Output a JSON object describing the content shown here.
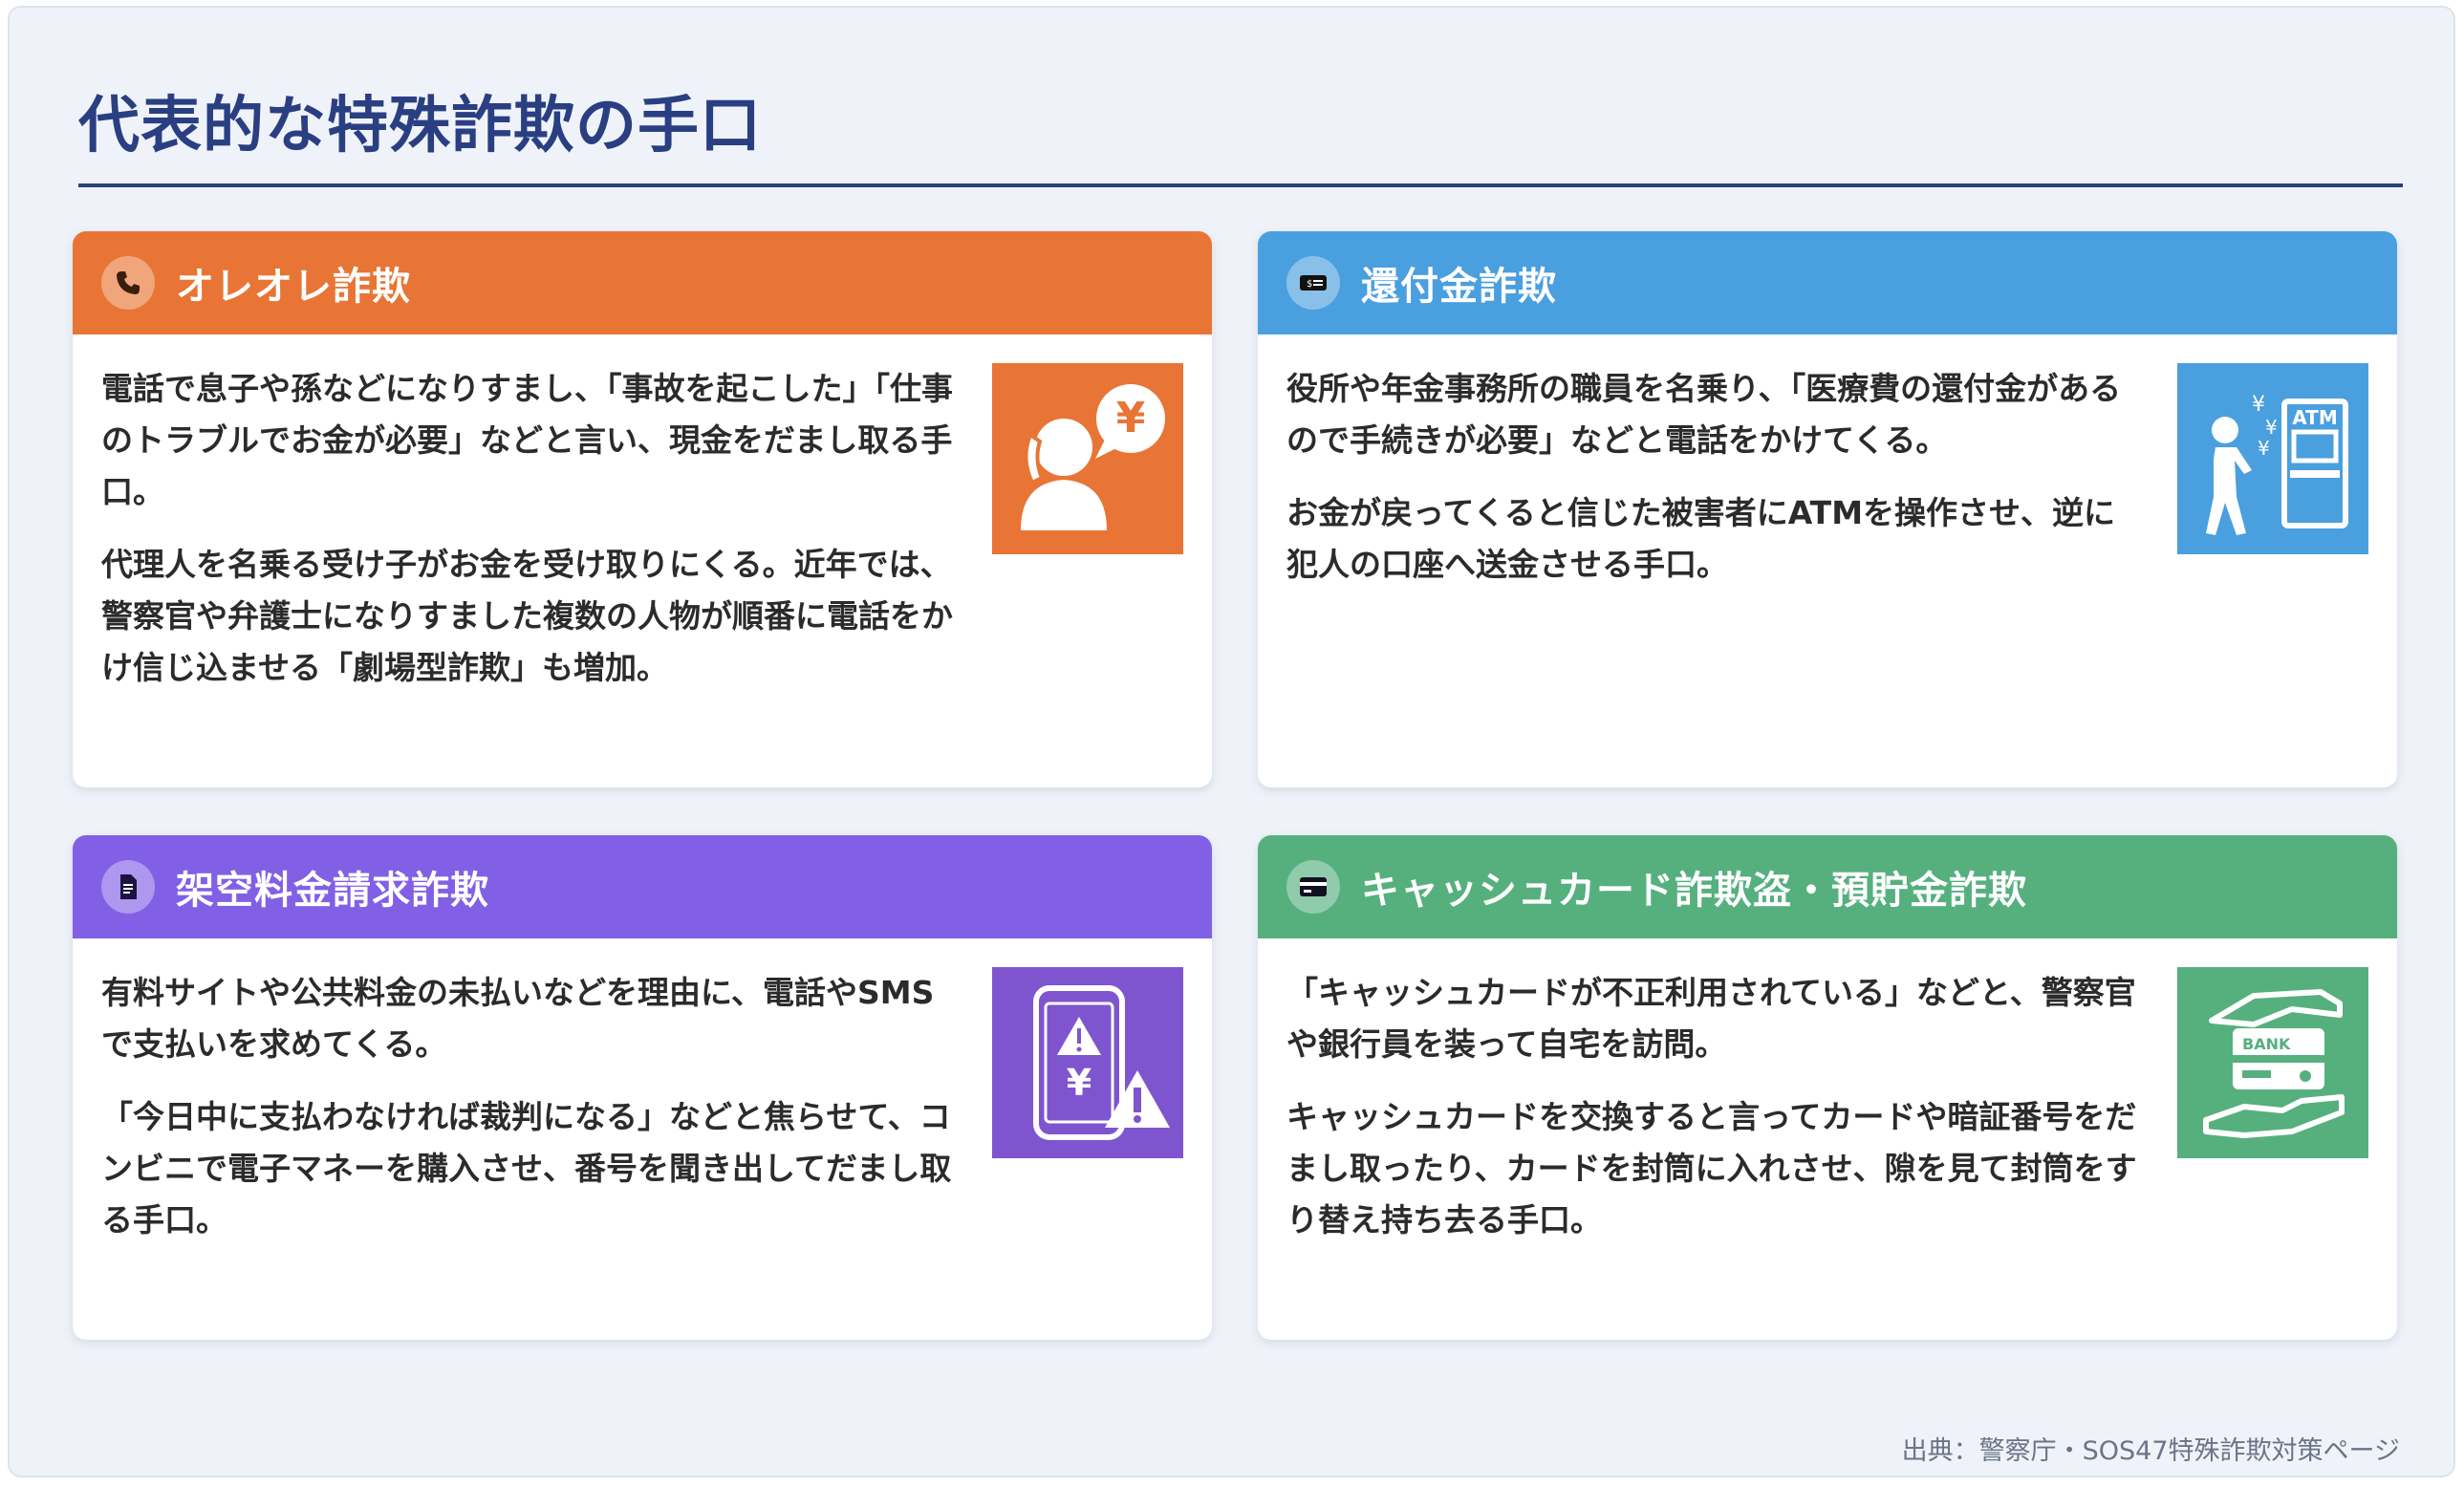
{
  "title": "代表的な特殊詐欺の手口",
  "cards": [
    {
      "title": "オレオレ詐欺",
      "icon": "phone-icon",
      "illustration": "person-on-phone-yen-illustration",
      "color": "#e87535",
      "paragraphs": [
        "電話で息子や孫などになりすまし、「事故を起こした」「仕事のトラブルでお金が必要」などと言い、現金をだまし取る手口。",
        "代理人を名乗る受け子がお金を受け取りにくる。近年では、警察官や弁護士になりすました複数の人物が順番に電話をかけ信じ込ませる「劇場型詐欺」も増加。"
      ]
    },
    {
      "title": "還付金詐欺",
      "icon": "money-bill-icon",
      "illustration": "person-at-atm-illustration",
      "color": "#4a9fdf",
      "paragraphs": [
        "役所や年金事務所の職員を名乗り、「医療費の還付金があるので手続きが必要」などと電話をかけてくる。",
        "お金が戻ってくると信じた被害者にATMを操作させ、逆に犯人の口座へ送金させる手口。"
      ]
    },
    {
      "title": "架空料金請求詐欺",
      "icon": "document-icon",
      "illustration": "phone-warning-yen-illustration",
      "color": "#8160e6",
      "paragraphs": [
        "有料サイトや公共料金の未払いなどを理由に、電話やSMSで支払いを求めてくる。",
        "「今日中に支払わなければ裁判になる」などと焦らせて、コンビニで電子マネーを購入させ、番号を聞き出してだまし取る手口。"
      ]
    },
    {
      "title": "キャッシュカード詐欺盗・預貯金詐欺",
      "icon": "credit-card-icon",
      "illustration": "hands-holding-bank-card-illustration",
      "color": "#55b07e",
      "paragraphs": [
        "「キャッシュカードが不正利用されている」などと、警察官や銀行員を装って自宅を訪問。",
        "キャッシュカードを交換すると言ってカードや暗証番号をだまし取ったり、カードを封筒に入れさせ、隙を見て封筒をすり替え持ち去る手口。"
      ]
    }
  ],
  "illustration_labels": {
    "yen": "¥",
    "atm": "ATM",
    "bank": "BANK"
  },
  "source": "出典：警察庁・SOS47特殊詐欺対策ページ"
}
